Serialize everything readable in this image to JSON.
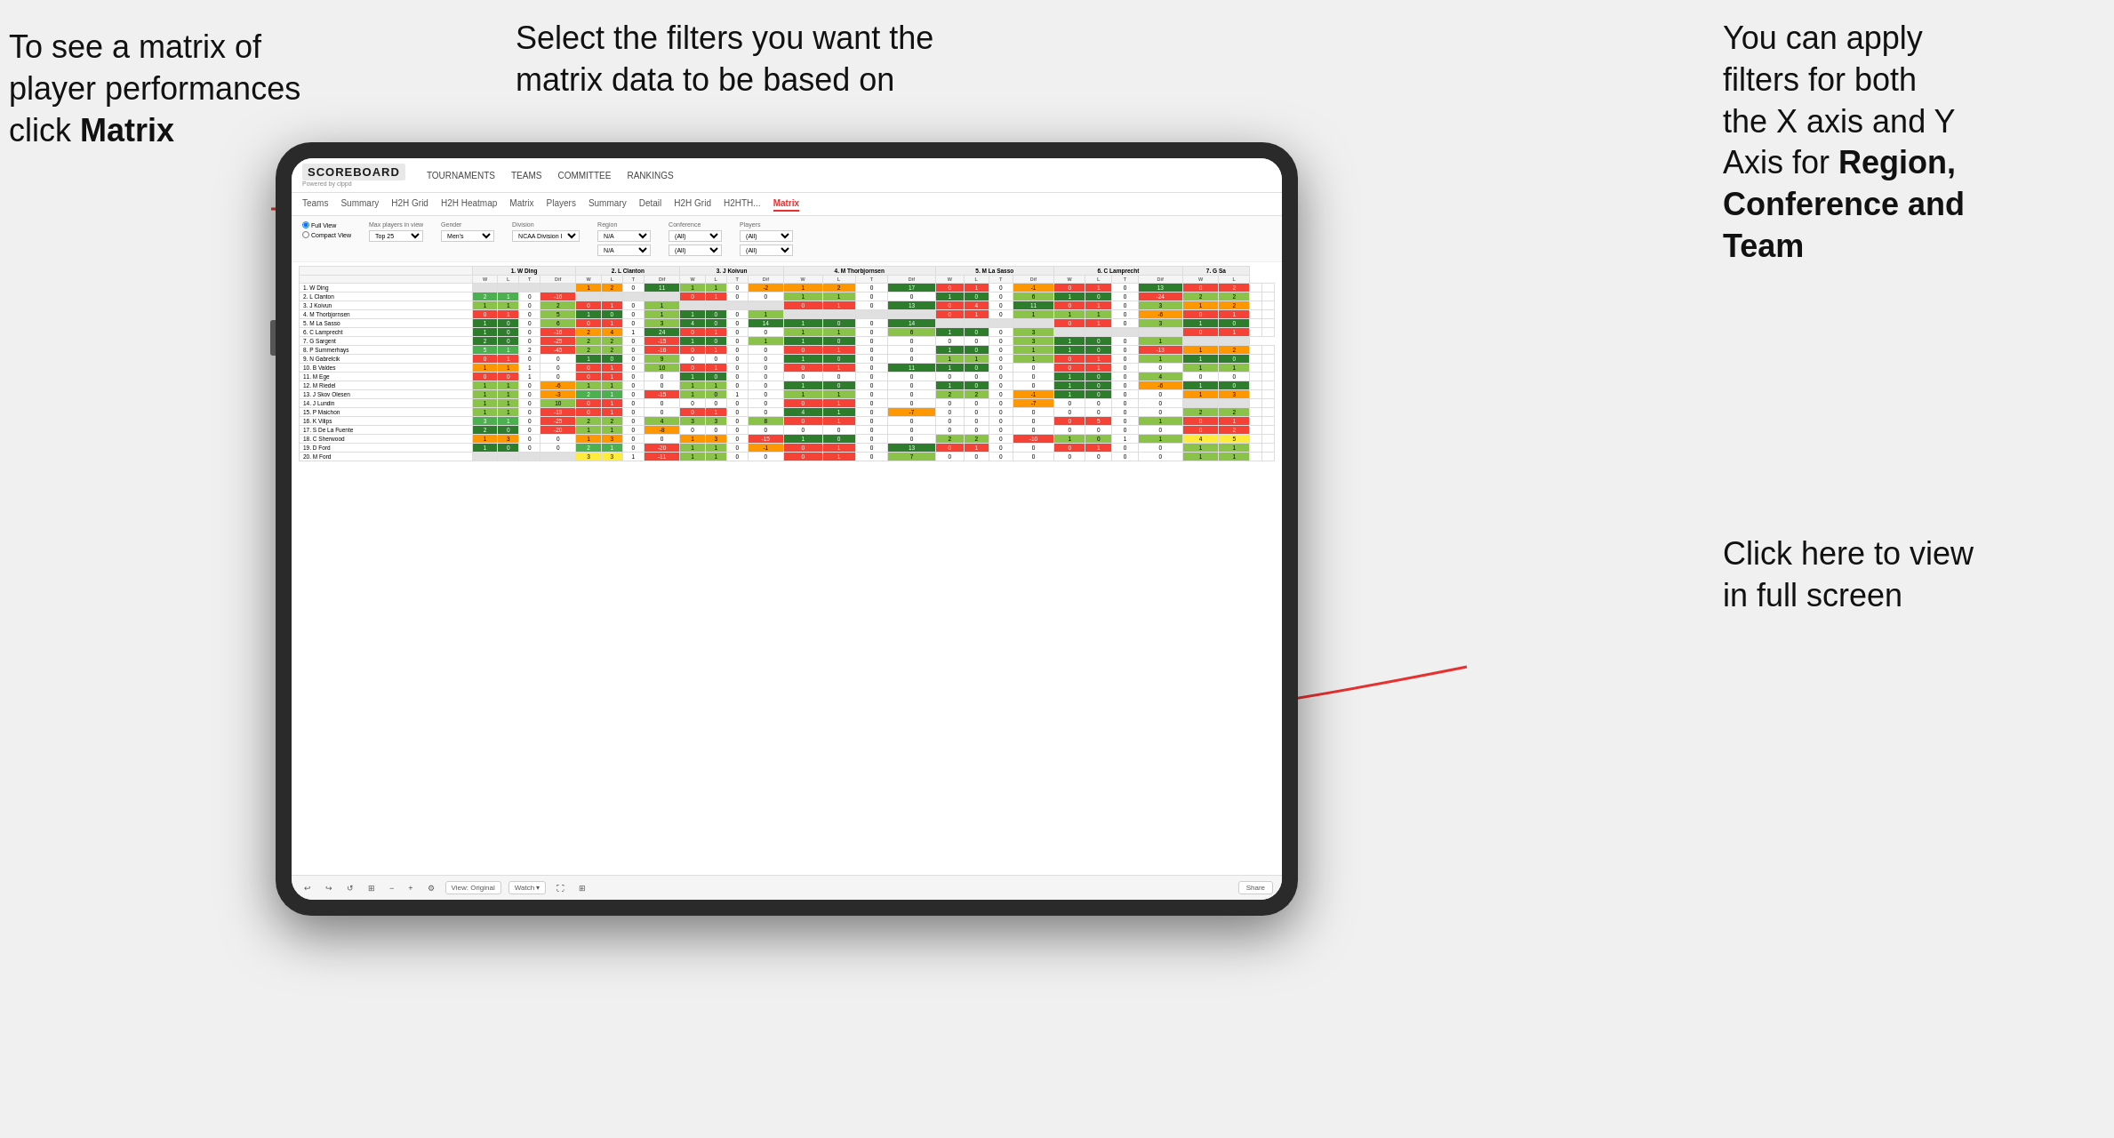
{
  "annotations": {
    "top_left": {
      "line1": "To see a matrix of",
      "line2": "player performances",
      "line3_prefix": "click ",
      "line3_bold": "Matrix"
    },
    "top_mid": {
      "text": "Select the filters you want the matrix data to be based on"
    },
    "top_right": {
      "line1": "You  can apply",
      "line2": "filters for both",
      "line3": "the X axis and Y",
      "line4_prefix": "Axis for ",
      "line4_bold": "Region,",
      "line5_bold": "Conference and",
      "line6_bold": "Team"
    },
    "bottom_right": {
      "line1": "Click here to view",
      "line2": "in full screen"
    }
  },
  "nav": {
    "brand": "SCOREBOARD",
    "powered_by": "Powered by clppd",
    "items": [
      "TOURNAMENTS",
      "TEAMS",
      "COMMITTEE",
      "RANKINGS"
    ]
  },
  "sub_nav": {
    "tabs": [
      "Teams",
      "Summary",
      "H2H Grid",
      "H2H Heatmap",
      "Matrix",
      "Players",
      "Summary",
      "Detail",
      "H2H Grid",
      "H2HTH...",
      "Matrix"
    ]
  },
  "filters": {
    "view_options": [
      "Full View",
      "Compact View"
    ],
    "max_players_label": "Max players in view",
    "max_players_value": "Top 25",
    "gender_label": "Gender",
    "gender_value": "Men's",
    "division_label": "Division",
    "division_value": "NCAA Division I",
    "region_label": "Region",
    "region_value": "N/A",
    "region_value2": "N/A",
    "conference_label": "Conference",
    "conference_value": "(All)",
    "conference_value2": "(All)",
    "players_label": "Players",
    "players_value": "(All)",
    "players_value2": "(All)"
  },
  "matrix": {
    "col_headers": [
      "1. W Ding",
      "2. L Clanton",
      "3. J Koivun",
      "4. M Thorbjornsen",
      "5. M La Sasso",
      "6. C Lamprecht",
      "7. G Sa"
    ],
    "sub_headers": [
      "W",
      "L",
      "T",
      "Dif"
    ],
    "rows": [
      {
        "name": "1. W Ding",
        "data": [
          [
            null,
            null,
            null,
            null
          ],
          [
            1,
            2,
            0,
            11
          ],
          [
            1,
            1,
            0,
            -2
          ],
          [
            1,
            2,
            0,
            17
          ],
          [
            0,
            1,
            0,
            -1
          ],
          [
            0,
            1,
            0,
            13
          ],
          [
            0,
            2
          ]
        ]
      },
      {
        "name": "2. L Clanton",
        "data": [
          [
            2,
            1,
            0,
            -16
          ],
          [
            null,
            null,
            null,
            null
          ],
          [
            0,
            1,
            0,
            0
          ],
          [
            1,
            1,
            0,
            0
          ],
          [
            1,
            0,
            0,
            6
          ],
          [
            1,
            0,
            0,
            -24
          ],
          [
            2,
            2
          ]
        ]
      },
      {
        "name": "3. J Koivun",
        "data": [
          [
            1,
            1,
            0,
            2
          ],
          [
            0,
            1,
            0,
            1
          ],
          [
            null,
            null,
            null,
            null
          ],
          [
            0,
            1,
            0,
            13
          ],
          [
            0,
            4,
            0,
            11
          ],
          [
            0,
            1,
            0,
            3
          ],
          [
            1,
            2
          ]
        ]
      },
      {
        "name": "4. M Thorbjornsen",
        "data": [
          [
            0,
            1,
            0,
            5
          ],
          [
            1,
            0,
            0,
            1
          ],
          [
            1,
            0,
            0,
            1
          ],
          [
            null,
            null,
            null,
            null
          ],
          [
            0,
            1,
            0,
            1
          ],
          [
            1,
            1,
            0,
            -6
          ],
          [
            0,
            1
          ]
        ]
      },
      {
        "name": "5. M La Sasso",
        "data": [
          [
            1,
            0,
            0,
            6
          ],
          [
            0,
            1,
            0,
            3
          ],
          [
            4,
            0,
            0,
            14
          ],
          [
            1,
            0,
            0,
            14
          ],
          [
            null,
            null,
            null,
            null
          ],
          [
            0,
            1,
            0,
            3
          ],
          [
            1,
            0
          ]
        ]
      },
      {
        "name": "6. C Lamprecht",
        "data": [
          [
            1,
            0,
            0,
            -16
          ],
          [
            2,
            4,
            1,
            24
          ],
          [
            0,
            1,
            0,
            0
          ],
          [
            1,
            1,
            0,
            6
          ],
          [
            1,
            0,
            0,
            3
          ],
          [
            null,
            null,
            null,
            null
          ],
          [
            0,
            1
          ]
        ]
      },
      {
        "name": "7. G Sargent",
        "data": [
          [
            2,
            0,
            0,
            -25
          ],
          [
            2,
            2,
            0,
            -15
          ],
          [
            1,
            0,
            0,
            1
          ],
          [
            1,
            0,
            0,
            0
          ],
          [
            0,
            0,
            0,
            3
          ],
          [
            1,
            0,
            0,
            1
          ],
          [
            null,
            null
          ]
        ]
      },
      {
        "name": "8. P Summerhays",
        "data": [
          [
            5,
            1,
            2,
            -45
          ],
          [
            2,
            2,
            0,
            -16
          ],
          [
            0,
            1,
            0,
            0
          ],
          [
            0,
            1,
            0,
            0
          ],
          [
            1,
            0,
            0,
            1
          ],
          [
            1,
            0,
            0,
            -13
          ],
          [
            1,
            2
          ]
        ]
      },
      {
        "name": "9. N Gabrelcik",
        "data": [
          [
            0,
            1,
            0,
            0
          ],
          [
            1,
            0,
            0,
            9
          ],
          [
            0,
            0,
            0,
            0
          ],
          [
            1,
            0,
            0,
            0
          ],
          [
            1,
            1,
            0,
            1
          ],
          [
            0,
            1,
            0,
            1
          ],
          [
            1,
            0
          ]
        ]
      },
      {
        "name": "10. B Valdes",
        "data": [
          [
            1,
            1,
            1,
            0
          ],
          [
            0,
            1,
            0,
            10
          ],
          [
            0,
            1,
            0,
            0
          ],
          [
            0,
            1,
            0,
            11
          ],
          [
            1,
            0,
            0,
            0
          ],
          [
            0,
            1,
            0,
            0
          ],
          [
            1,
            1
          ]
        ]
      },
      {
        "name": "11. M Ege",
        "data": [
          [
            0,
            0,
            1,
            0
          ],
          [
            0,
            1,
            0,
            0
          ],
          [
            1,
            0,
            0,
            0
          ],
          [
            0,
            0,
            0,
            0
          ],
          [
            0,
            0,
            0,
            0
          ],
          [
            1,
            0,
            0,
            4
          ],
          [
            0,
            0
          ]
        ]
      },
      {
        "name": "12. M Riedel",
        "data": [
          [
            1,
            1,
            0,
            -6
          ],
          [
            1,
            1,
            0,
            0
          ],
          [
            1,
            1,
            0,
            0
          ],
          [
            1,
            0,
            0,
            0
          ],
          [
            1,
            0,
            0,
            0
          ],
          [
            1,
            0,
            0,
            -6
          ],
          [
            1,
            0
          ]
        ]
      },
      {
        "name": "13. J Skov Olesen",
        "data": [
          [
            1,
            1,
            0,
            -3
          ],
          [
            2,
            1,
            0,
            -15
          ],
          [
            1,
            0,
            1,
            0
          ],
          [
            1,
            1,
            0,
            0
          ],
          [
            2,
            2,
            0,
            -1
          ],
          [
            1,
            0,
            0,
            0
          ],
          [
            1,
            3
          ]
        ]
      },
      {
        "name": "14. J Lundin",
        "data": [
          [
            1,
            1,
            0,
            10
          ],
          [
            0,
            1,
            0,
            0
          ],
          [
            0,
            0,
            0,
            0
          ],
          [
            0,
            1,
            0,
            0
          ],
          [
            0,
            0,
            0,
            -7
          ],
          [
            0,
            0,
            0,
            0
          ],
          [
            null,
            null
          ]
        ]
      },
      {
        "name": "15. P Maichon",
        "data": [
          [
            1,
            1,
            0,
            -19
          ],
          [
            0,
            1,
            0,
            0
          ],
          [
            0,
            1,
            0,
            0
          ],
          [
            4,
            1,
            0,
            -7
          ],
          [
            0,
            0,
            0,
            0
          ],
          [
            0,
            0,
            0,
            0
          ],
          [
            2,
            2
          ]
        ]
      },
      {
        "name": "16. K Vilips",
        "data": [
          [
            3,
            1,
            0,
            -25
          ],
          [
            2,
            2,
            0,
            4
          ],
          [
            3,
            3,
            0,
            8
          ],
          [
            0,
            1,
            0,
            0
          ],
          [
            0,
            0,
            0,
            0
          ],
          [
            0,
            5,
            0,
            1
          ],
          [
            0,
            1
          ]
        ]
      },
      {
        "name": "17. S De La Fuente",
        "data": [
          [
            2,
            0,
            0,
            -20
          ],
          [
            1,
            1,
            0,
            -8
          ],
          [
            0,
            0,
            0,
            0
          ],
          [
            0,
            0,
            0,
            0
          ],
          [
            0,
            0,
            0,
            0
          ],
          [
            0,
            0,
            0,
            0
          ],
          [
            0,
            2
          ]
        ]
      },
      {
        "name": "18. C Sherwood",
        "data": [
          [
            1,
            3,
            0,
            0
          ],
          [
            1,
            3,
            0,
            0
          ],
          [
            1,
            3,
            0,
            -15
          ],
          [
            1,
            0,
            0,
            0
          ],
          [
            2,
            2,
            0,
            -10
          ],
          [
            1,
            0,
            1,
            1
          ],
          [
            4,
            5
          ]
        ]
      },
      {
        "name": "19. D Ford",
        "data": [
          [
            1,
            0,
            0,
            0
          ],
          [
            2,
            1,
            0,
            -20
          ],
          [
            1,
            1,
            0,
            -1
          ],
          [
            0,
            1,
            0,
            13
          ],
          [
            0,
            1,
            0,
            0
          ],
          [
            0,
            1,
            0,
            0
          ],
          [
            1,
            1
          ]
        ]
      },
      {
        "name": "20. M Ford",
        "data": [
          [
            null,
            null,
            null,
            null
          ],
          [
            3,
            3,
            1,
            -11
          ],
          [
            1,
            1,
            0,
            0
          ],
          [
            0,
            1,
            0,
            7
          ],
          [
            0,
            0,
            0,
            0
          ],
          [
            0,
            0,
            0,
            0
          ],
          [
            1,
            1
          ]
        ]
      }
    ]
  },
  "toolbar": {
    "view_label": "View: Original",
    "watch_label": "Watch ▾",
    "share_label": "Share"
  },
  "colors": {
    "arrow": "#e83030",
    "active_tab": "#e83030"
  }
}
